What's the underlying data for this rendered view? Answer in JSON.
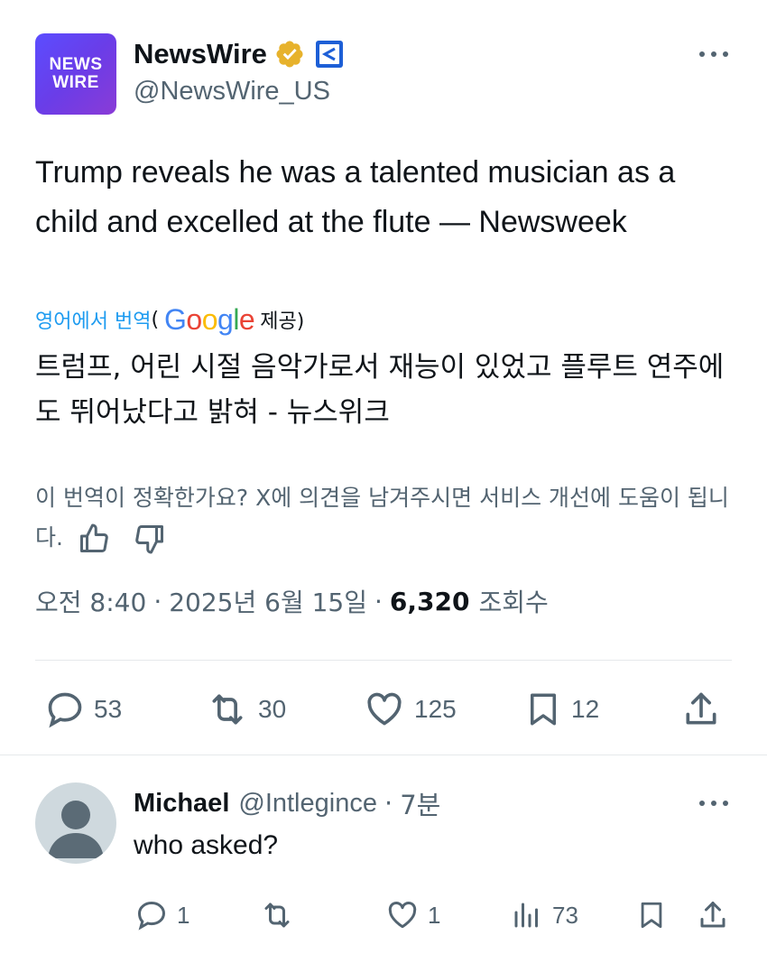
{
  "tweet": {
    "logo_text": [
      "NEWS",
      "WIRE"
    ],
    "author_name": "NewsWire",
    "handle": "@NewsWire_US",
    "text": "Trump reveals he was a talented musician as a child and excelled at the flute — Newsweek",
    "translate": {
      "link": "영어에서 번역",
      "paren_open": "(",
      "provider_letters": [
        "G",
        "o",
        "o",
        "g",
        "l",
        "e"
      ],
      "provided": "제공)"
    },
    "translated_text": "트럼프, 어린 시절 음악가로서 재능이 있었고 플루트 연주에도 뛰어났다고 밝혀 - 뉴스위크",
    "feedback": "이 번역이 정확한가요? X에 의견을 남겨주시면 서비스 개선에 도움이 됩니다.",
    "time": "오전 8:40",
    "date": "2025년 6월 15일",
    "views": "6,320",
    "views_label": "조회수",
    "separator": "·",
    "actions": {
      "replies": "53",
      "reposts": "30",
      "likes": "125",
      "bookmarks": "12"
    },
    "brand_color": "#1d9bf0",
    "verified_color": "#e7b22c",
    "affiliate_color": "#1d5fd6"
  },
  "reply": {
    "name": "Michael",
    "handle": "@Intlegince",
    "separator": "·",
    "time": "7분",
    "text": "who asked?",
    "actions": {
      "replies": "1",
      "likes": "1",
      "views": "73"
    }
  }
}
